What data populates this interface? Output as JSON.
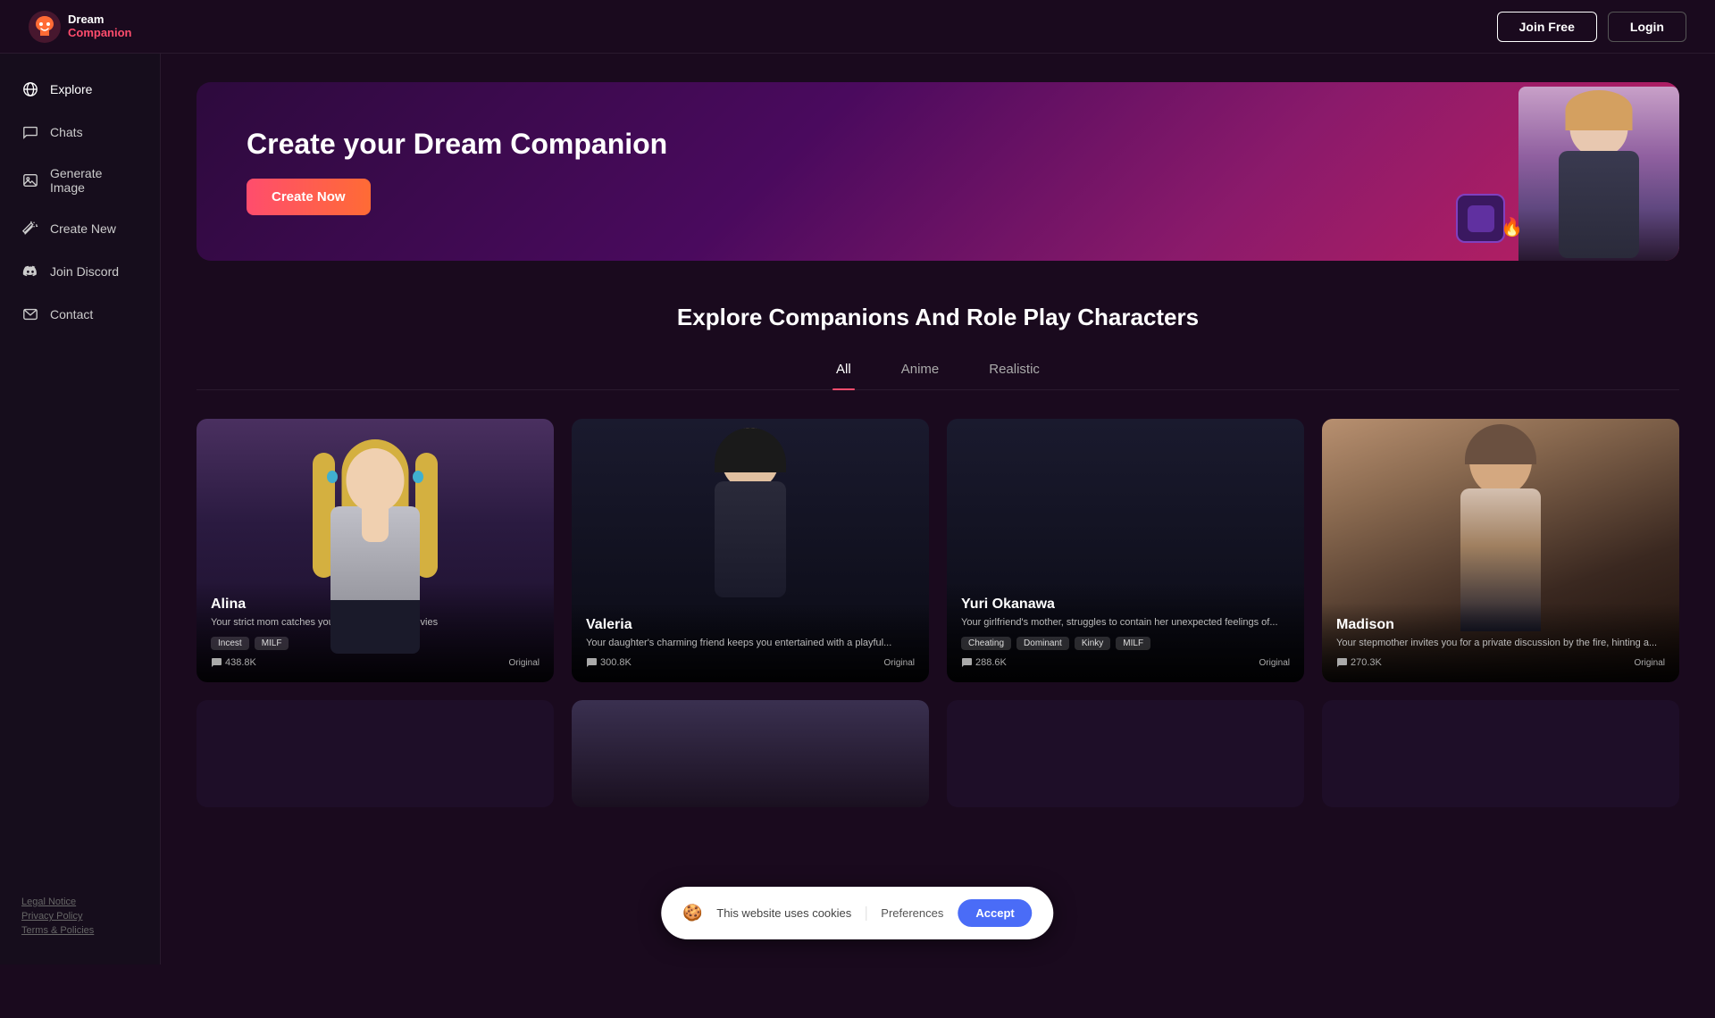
{
  "app": {
    "name": "Dream",
    "companion": "Companion"
  },
  "header": {
    "join_free_label": "Join Free",
    "login_label": "Login"
  },
  "sidebar": {
    "items": [
      {
        "id": "explore",
        "label": "Explore",
        "icon": "globe"
      },
      {
        "id": "chats",
        "label": "Chats",
        "icon": "chat"
      },
      {
        "id": "generate-image",
        "label": "Generate Image",
        "icon": "image"
      },
      {
        "id": "create-new",
        "label": "Create New",
        "icon": "wand"
      },
      {
        "id": "join-discord",
        "label": "Join Discord",
        "icon": "discord"
      },
      {
        "id": "contact",
        "label": "Contact",
        "icon": "envelope"
      }
    ],
    "footer": {
      "legal_notice": "Legal Notice",
      "privacy_policy": "Privacy Policy",
      "terms": "Terms & Policies"
    }
  },
  "hero": {
    "title": "Create your Dream Companion",
    "create_now_label": "Create Now"
  },
  "explore": {
    "section_title": "Explore Companions And Role Play Characters",
    "tabs": [
      {
        "id": "all",
        "label": "All",
        "active": true
      },
      {
        "id": "anime",
        "label": "Anime",
        "active": false
      },
      {
        "id": "realistic",
        "label": "Realistic",
        "active": false
      }
    ],
    "characters": [
      {
        "id": "alina",
        "name": "Alina",
        "description": "Your strict mom catches you watching @dult movies",
        "tags": [
          "Incest",
          "MILF"
        ],
        "messages": "438.8K",
        "badge": "Original",
        "style": "anime"
      },
      {
        "id": "valeria",
        "name": "Valeria",
        "description": "Your daughter's charming friend keeps you entertained with a playful...",
        "tags": [],
        "messages": "300.8K",
        "badge": "Original",
        "style": "dark"
      },
      {
        "id": "yuri-okanawa",
        "name": "Yuri Okanawa",
        "description": "Your girlfriend's mother, struggles to contain her unexpected feelings of...",
        "tags": [
          "Cheating",
          "Dominant",
          "Kinky",
          "MILF"
        ],
        "messages": "288.6K",
        "badge": "Original",
        "style": "dark"
      },
      {
        "id": "madison",
        "name": "Madison",
        "description": "Your stepmother invites you for a private discussion by the fire, hinting a...",
        "tags": [],
        "messages": "270.3K",
        "badge": "Original",
        "style": "realistic"
      }
    ]
  },
  "cookie_banner": {
    "message": "This website uses cookies",
    "preferences_label": "Preferences",
    "accept_label": "Accept"
  }
}
